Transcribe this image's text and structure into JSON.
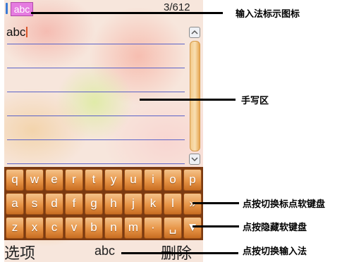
{
  "status_bar": {
    "ime_indicator": "abc",
    "char_count": "3/612"
  },
  "editor": {
    "text": "abc",
    "scroll_up_icon": "chevron-up-icon",
    "scroll_down_icon": "chevron-down-icon"
  },
  "keyboard": {
    "rows": [
      [
        "q",
        "w",
        "e",
        "r",
        "t",
        "y",
        "u",
        "i",
        "o",
        "p"
      ],
      [
        "a",
        "s",
        "d",
        "f",
        "g",
        "h",
        "j",
        "k",
        "l",
        "»"
      ],
      [
        "z",
        "x",
        "c",
        "v",
        "b",
        "n",
        "m",
        "·",
        "␣",
        "▼"
      ]
    ],
    "key_color": "#e79446"
  },
  "softkeys": {
    "left": "选项",
    "center": "abc",
    "right": "删除"
  },
  "callouts": {
    "ime_icon": "输入法标示图标",
    "handwriting_area": "手写区",
    "symbol_toggle": "点按切换标点软键盘",
    "hide_keyboard": "点按隐藏软键盘",
    "switch_ime": "点按切换输入法"
  },
  "colors": {
    "ime_icon_bg": "#e57be0",
    "ruled_line": "#5b63c8",
    "callout": "#000000"
  }
}
